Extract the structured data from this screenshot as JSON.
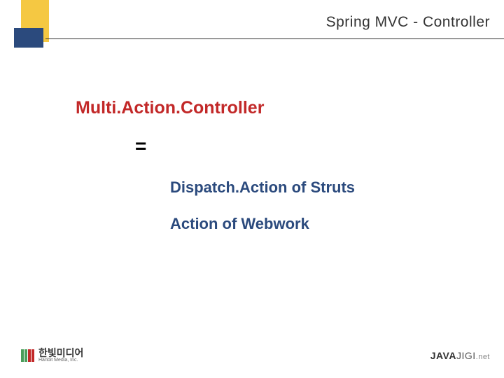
{
  "header": {
    "title": "Spring MVC - Controller"
  },
  "content": {
    "heading": "Multi.Action.Controller",
    "equals": "=",
    "items": [
      "Dispatch.Action of Struts",
      "Action of Webwork"
    ]
  },
  "footer": {
    "left_brand": "한빛미디어",
    "left_subtext": "Hanbit Media, Inc.",
    "right_prefix": "JAVA",
    "right_suffix": "JIGI",
    "right_domain": ".net"
  }
}
